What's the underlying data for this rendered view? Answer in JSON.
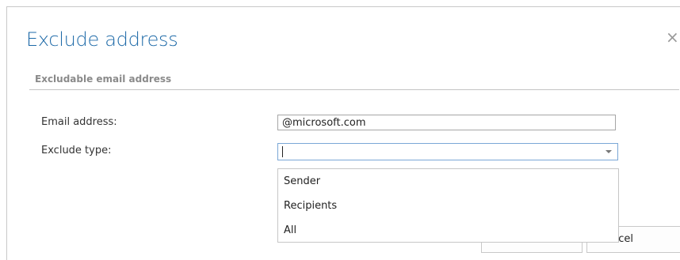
{
  "dialog": {
    "title": "Exclude address",
    "close_glyph": "×",
    "section_label": "Excludable email address",
    "email_label": "Email address:",
    "email_value": "@microsoft.com",
    "exclude_type_label": "Exclude type:",
    "exclude_type_value": "",
    "options": [
      "Sender",
      "Recipients",
      "All"
    ],
    "ok_label": "",
    "cancel_label": "Cancel"
  },
  "colors": {
    "title": "#1e6aa8",
    "select_focus_border": "#7aa7d6"
  },
  "icons": {
    "close": "close-icon",
    "dropdown": "chevron-down-icon"
  }
}
